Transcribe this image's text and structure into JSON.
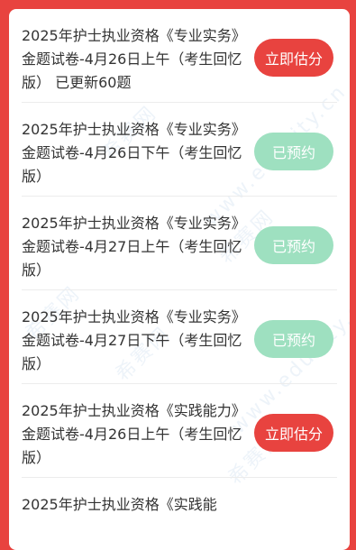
{
  "watermark": {
    "site": "www.educity.cn",
    "brand": "希赛网"
  },
  "colors": {
    "primary": "#e8433f",
    "reserved": "#9ee0c0"
  },
  "items": [
    {
      "title": "2025年护士执业资格《专业实务》金题试卷-4月26日上午（考生回忆版） 已更新60题",
      "action": "立即估分",
      "state": "primary"
    },
    {
      "title": "2025年护士执业资格《专业实务》金题试卷-4月26日下午（考生回忆版）",
      "action": "已预约",
      "state": "reserved"
    },
    {
      "title": "2025年护士执业资格《专业实务》金题试卷-4月27日上午（考生回忆版）",
      "action": "已预约",
      "state": "reserved"
    },
    {
      "title": "2025年护士执业资格《专业实务》金题试卷-4月27日下午（考生回忆版）",
      "action": "已预约",
      "state": "reserved"
    },
    {
      "title": "2025年护士执业资格《实践能力》金题试卷-4月26日上午（考生回忆版）",
      "action": "立即估分",
      "state": "primary"
    },
    {
      "title": "2025年护士执业资格《实践能",
      "action": "",
      "state": ""
    }
  ]
}
